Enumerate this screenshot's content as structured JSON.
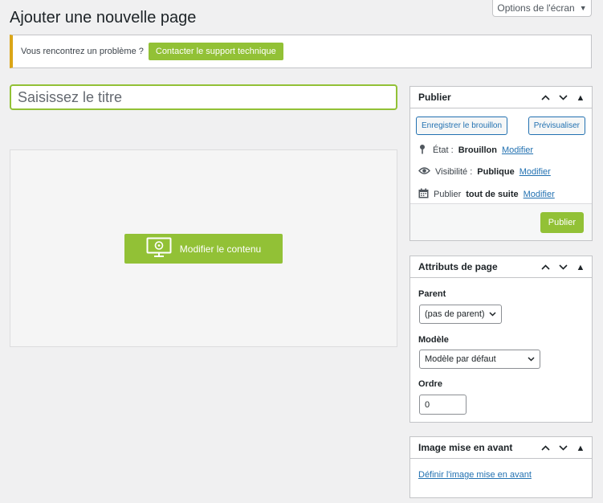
{
  "page": {
    "title": "Ajouter une nouvelle page"
  },
  "screen_options": {
    "label": "Options de l'écran"
  },
  "notice": {
    "text": "Vous rencontrez un problème ?",
    "button": "Contacter le support technique"
  },
  "editor": {
    "title_placeholder": "Saisissez le titre",
    "edit_button": "Modifier le contenu"
  },
  "publish": {
    "title": "Publier",
    "save_draft": "Enregistrer le brouillon",
    "preview": "Prévisualiser",
    "status_label": "État :",
    "status_value": "Brouillon",
    "visibility_label": "Visibilité :",
    "visibility_value": "Publique",
    "schedule_label": "Publier",
    "schedule_value": "tout de suite",
    "edit_link": "Modifier",
    "publish_button": "Publier"
  },
  "attributes": {
    "title": "Attributs de page",
    "parent_label": "Parent",
    "parent_value": "(pas de parent)",
    "template_label": "Modèle",
    "template_value": "Modèle par défaut",
    "order_label": "Ordre",
    "order_value": "0"
  },
  "featured_image": {
    "title": "Image mise en avant",
    "link": "Définir l'image mise en avant"
  }
}
